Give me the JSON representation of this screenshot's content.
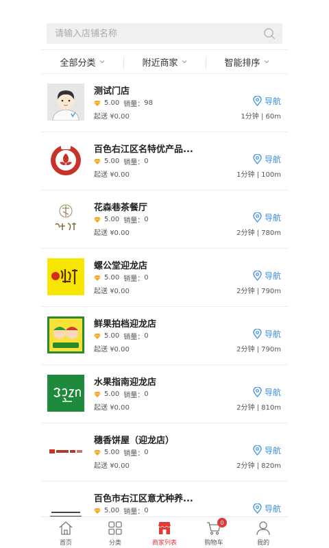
{
  "search": {
    "placeholder": "请输入店铺名称"
  },
  "filters": [
    {
      "label": "全部分类"
    },
    {
      "label": "附近商家"
    },
    {
      "label": "智能排序"
    }
  ],
  "labels": {
    "sales_prefix": "销量：",
    "delivery_prefix": "起送",
    "nav": "导航"
  },
  "stores": [
    {
      "name": "测试门店",
      "rating": "5.00",
      "sales": "98",
      "min_order": "¥0.00",
      "distance": "1分钟 | 60m",
      "logo": "avatar-boy"
    },
    {
      "name": "百色右江区名特优产品...",
      "rating": "5.00",
      "sales": "0",
      "min_order": "¥0.00",
      "distance": "1分钟 | 100m",
      "logo": "red-flower-circle"
    },
    {
      "name": "花森巷茶餐厅",
      "rating": "5.00",
      "sales": "0",
      "min_order": "¥0.00",
      "distance": "2分钟 | 780m",
      "logo": "calligraphy-brown"
    },
    {
      "name": "螺公堂迎龙店",
      "rating": "5.00",
      "sales": "0",
      "min_order": "¥0.00",
      "distance": "2分钟 | 790m",
      "logo": "yellow-calligraphy"
    },
    {
      "name": "鲜果拍档迎龙店",
      "rating": "5.00",
      "sales": "0",
      "min_order": "¥0.00",
      "distance": "2分钟 | 790m",
      "logo": "green-fruit-kids"
    },
    {
      "name": "水果指南迎龙店",
      "rating": "5.00",
      "sales": "0",
      "min_order": "¥0.00",
      "distance": "2分钟 | 810m",
      "logo": "sgzn-green"
    },
    {
      "name": "穗香饼屋（迎龙店）",
      "rating": "5.00",
      "sales": "0",
      "min_order": "¥0.00",
      "distance": "2分钟 | 820m",
      "logo": "bakery-banner"
    },
    {
      "name": "百色市右江区意尤种养...",
      "rating": "5.00",
      "sales": "0",
      "min_order": "",
      "distance": "",
      "logo": "text-logo"
    }
  ],
  "tabbar": [
    {
      "label": "首页",
      "icon": "home-icon"
    },
    {
      "label": "分类",
      "icon": "category-icon"
    },
    {
      "label": "商家列表",
      "icon": "shop-icon",
      "active": true
    },
    {
      "label": "购物车",
      "icon": "cart-icon",
      "badge": "0"
    },
    {
      "label": "我的",
      "icon": "user-icon"
    }
  ],
  "colors": {
    "accent": "#e0393a",
    "nav_blue": "#3a8ee6"
  }
}
